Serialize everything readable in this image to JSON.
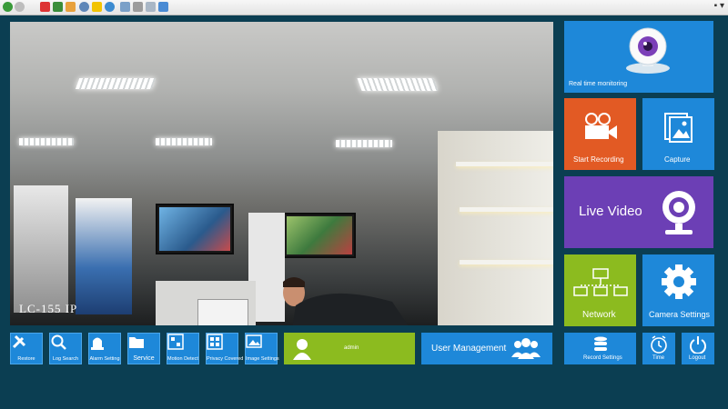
{
  "video": {
    "label": "LC-155 IP"
  },
  "tiles": {
    "realtime": "Real time monitoring",
    "start_recording": "Start Recording",
    "capture": "Capture",
    "live_video": "Live Video",
    "network": "Network",
    "camera_settings": "Camera Settings"
  },
  "bottom_buttons": [
    "Restore",
    "Log Search",
    "Alarm Setting",
    "Service",
    "Motion Detect",
    "Privacy Covered",
    "Image Settings"
  ],
  "user": {
    "name": "admin"
  },
  "user_management": "User Management",
  "right_buttons": [
    "Record Settings",
    "Time",
    "Logout"
  ],
  "colors": {
    "background": "#0b3e52",
    "blue": "#1e88d9",
    "orange": "#e25a24",
    "purple": "#6c3fb5",
    "green": "#8cbb1f"
  }
}
